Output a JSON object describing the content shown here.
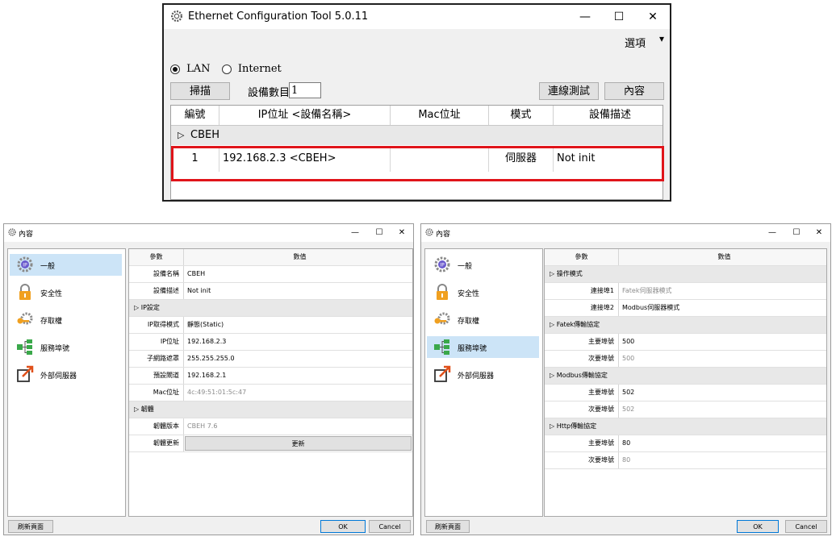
{
  "main": {
    "title": "Ethernet Configuration Tool 5.0.11",
    "window_controls": {
      "minimize": "—",
      "maximize": "☐",
      "close": "✕"
    },
    "menu": {
      "options_label": "選項",
      "arrow": "▾"
    },
    "mode": {
      "lan_label": "LAN",
      "internet_label": "Internet",
      "selected": "LAN"
    },
    "scan_label": "掃描",
    "device_count_label": "設備數目",
    "device_count_value": "1",
    "connection_test_label": "連線測試",
    "content_label": "內容",
    "table": {
      "headers": [
        "編號",
        "IP位址 <設備名稱>",
        "Mac位址",
        "模式",
        "設備描述"
      ],
      "group": "CBEH",
      "group_marker": "▷",
      "rows": [
        {
          "no": "1",
          "ip": "192.168.2.3 <CBEH>",
          "mac": "",
          "mode": "伺服器",
          "desc": "Not init"
        }
      ]
    },
    "highlight_color": "#e0141a"
  },
  "props_left": {
    "title": "內容",
    "controls": {
      "minimize": "—",
      "maximize": "☐",
      "close": "✕"
    },
    "sidebar": [
      {
        "label": "一般",
        "icon": "ip-gear-icon",
        "selected": true
      },
      {
        "label": "安全性",
        "icon": "padlock-icon",
        "selected": false
      },
      {
        "label": "存取權",
        "icon": "key-gear-icon",
        "selected": false
      },
      {
        "label": "服務埠號",
        "icon": "network-ports-icon",
        "selected": false
      },
      {
        "label": "外部伺服器",
        "icon": "external-link-icon",
        "selected": false
      }
    ],
    "header": {
      "param": "參數",
      "value": "數值"
    },
    "rows": [
      {
        "type": "kv",
        "k": "設備名稱",
        "v": "CBEH"
      },
      {
        "type": "kv",
        "k": "設備描述",
        "v": "Not init"
      },
      {
        "type": "group",
        "label": "IP設定"
      },
      {
        "type": "kv",
        "k": "IP取得模式",
        "v": "靜態(Static)"
      },
      {
        "type": "kv",
        "k": "IP位址",
        "v": "192.168.2.3"
      },
      {
        "type": "kv",
        "k": "子網路遮罩",
        "v": "255.255.255.0"
      },
      {
        "type": "kv",
        "k": "預設閘道",
        "v": "192.168.2.1"
      },
      {
        "type": "kv",
        "k": "Mac位址",
        "v": "4c:49:51:01:5c:47",
        "dim": true
      },
      {
        "type": "group",
        "label": "韌體"
      },
      {
        "type": "kv",
        "k": "韌體版本",
        "v": "CBEH 7.6",
        "dim": true
      },
      {
        "type": "button",
        "k": "韌體更新",
        "v": "更新"
      }
    ],
    "refresh_label": "刷新頁面",
    "ok_label": "OK",
    "cancel_label": "Cancel"
  },
  "props_right": {
    "title": "內容",
    "controls": {
      "minimize": "—",
      "maximize": "☐",
      "close": "✕"
    },
    "sidebar": [
      {
        "label": "一般",
        "icon": "ip-gear-icon",
        "selected": false
      },
      {
        "label": "安全性",
        "icon": "padlock-icon",
        "selected": false
      },
      {
        "label": "存取權",
        "icon": "key-gear-icon",
        "selected": false
      },
      {
        "label": "服務埠號",
        "icon": "network-ports-icon",
        "selected": true
      },
      {
        "label": "外部伺服器",
        "icon": "external-link-icon",
        "selected": false
      }
    ],
    "header": {
      "param": "參數",
      "value": "數值"
    },
    "rows": [
      {
        "type": "group",
        "label": "操作模式"
      },
      {
        "type": "kv",
        "k": "連接埠1",
        "v": "Fatek伺服器模式",
        "dim": true
      },
      {
        "type": "kv",
        "k": "連接埠2",
        "v": "Modbus伺服器模式"
      },
      {
        "type": "group",
        "label": "Fatek傳輸協定"
      },
      {
        "type": "kv",
        "k": "主要埠號",
        "v": "500"
      },
      {
        "type": "kv",
        "k": "次要埠號",
        "v": "500",
        "dim": true
      },
      {
        "type": "group",
        "label": "Modbus傳輸協定"
      },
      {
        "type": "kv",
        "k": "主要埠號",
        "v": "502"
      },
      {
        "type": "kv",
        "k": "次要埠號",
        "v": "502",
        "dim": true
      },
      {
        "type": "group",
        "label": "Http傳輸協定"
      },
      {
        "type": "kv",
        "k": "主要埠號",
        "v": "80"
      },
      {
        "type": "kv",
        "k": "次要埠號",
        "v": "80",
        "dim": true
      }
    ],
    "refresh_label": "刷新頁面",
    "ok_label": "OK",
    "cancel_label": "Cancel"
  }
}
